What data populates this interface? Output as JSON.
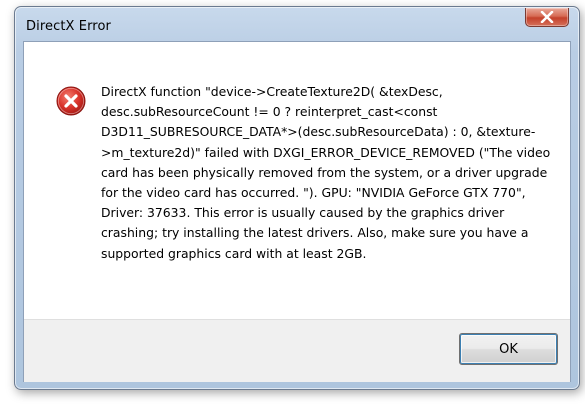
{
  "window": {
    "title": "DirectX Error"
  },
  "dialog": {
    "icon": "error-icon",
    "message": "DirectX function \"device->CreateTexture2D( &texDesc, desc.subResourceCount != 0 ? reinterpret_cast<const D3D11_SUBRESOURCE_DATA*>(desc.subResourceData) : 0, &texture->m_texture2d)\" failed with DXGI_ERROR_DEVICE_REMOVED (\"The video card has been physically removed from the system, or a driver upgrade for the video card has occurred. \"). GPU: \"NVIDIA GeForce GTX 770\", Driver: 37633. This error is usually caused by the graphics driver crashing; try installing the latest drivers. Also, make sure you have a supported graphics card with at least 2GB.",
    "ok_label": "OK"
  },
  "colors": {
    "error_red": "#c8201a",
    "close_button": "#c4412b",
    "frame": "#b9cde4"
  }
}
